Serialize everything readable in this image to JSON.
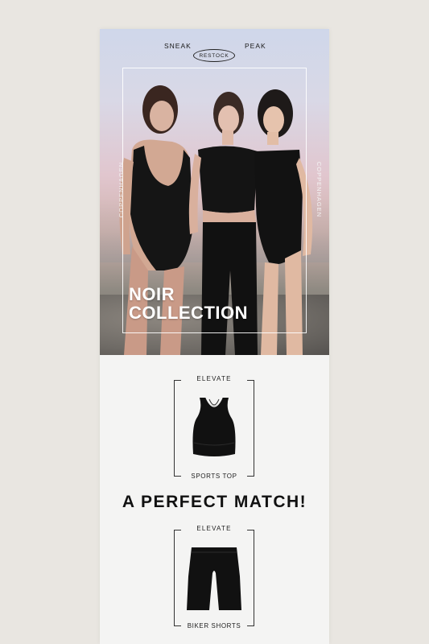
{
  "hero": {
    "brand_left": "SNEAK",
    "brand_right": "PEAK",
    "badge": "RESTOCK",
    "side_left": "COPPENHAGEN",
    "side_right": "COPPENHAGEN",
    "title_line1": "NOIR",
    "title_line2": "COLLECTION"
  },
  "products": [
    {
      "top_label": "ELEVATE",
      "bottom_label": "SPORTS TOP",
      "image": "sports-top-image"
    },
    {
      "top_label": "ELEVATE",
      "bottom_label": "BIKER SHORTS",
      "image": "biker-shorts-image"
    }
  ],
  "headline": "A PERFECT MATCH!",
  "colors": {
    "background": "#e9e6e1",
    "card": "#f4f4f3",
    "ink": "#111111"
  }
}
